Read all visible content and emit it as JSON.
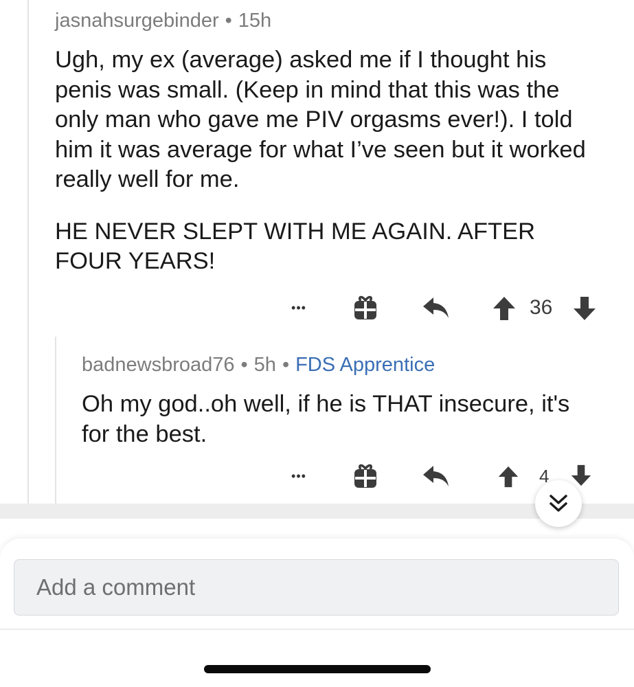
{
  "comment1": {
    "username": "jasnahsurgebinder",
    "time": "15h",
    "paragraphs": [
      "Ugh, my ex (average) asked me if I thought his penis was small. (Keep in mind that this was the only man who gave me PIV orgasms ever!). I told him it was average for what I’ve seen but it worked really well for me.",
      "HE NEVER SLEPT WITH ME AGAIN. AFTER FOUR YEARS!"
    ],
    "more_label": "•••",
    "votes": "36"
  },
  "comment2": {
    "username": "badnewsbroad76",
    "time": "5h",
    "flair": "FDS Apprentice",
    "paragraphs": [
      "Oh my god..oh well, if he is THAT insecure, it's for the best."
    ],
    "more_label": "•••",
    "votes": "4"
  },
  "meta_separator": "•",
  "composer": {
    "placeholder": "Add a comment"
  },
  "icons": {
    "gift": "gift-icon",
    "reply": "reply-arrow-icon",
    "upvote": "upvote-arrow-icon",
    "downvote": "downvote-arrow-icon",
    "jump": "double-chevron-down-icon"
  }
}
